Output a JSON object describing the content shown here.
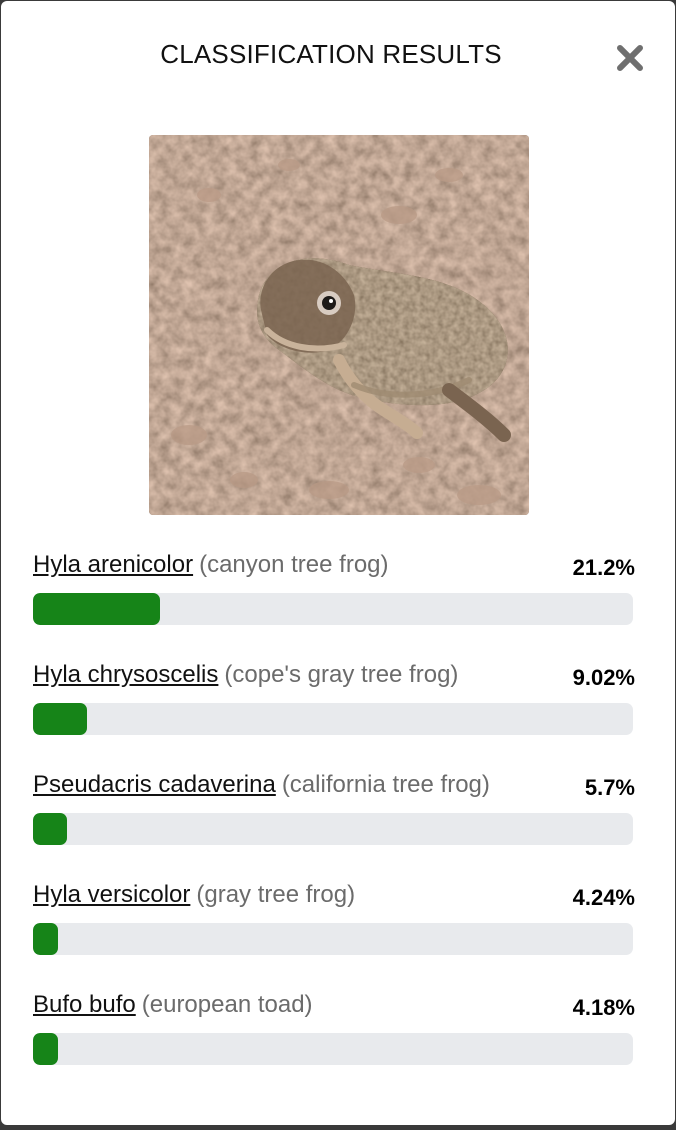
{
  "dialog": {
    "title": "CLASSIFICATION RESULTS",
    "close_icon": "close-icon"
  },
  "photo": {
    "icon": "frog-photo"
  },
  "results": [
    {
      "species": "Hyla arenicolor",
      "common": "(canyon tree frog)",
      "percent_label": "21.2%",
      "percent": 21.2
    },
    {
      "species": "Hyla chrysoscelis",
      "common": "(cope's gray tree frog)",
      "percent_label": "9.02%",
      "percent": 9.02
    },
    {
      "species": "Pseudacris cadaverina",
      "common": "(california tree frog)",
      "percent_label": "5.7%",
      "percent": 5.7
    },
    {
      "species": "Hyla versicolor",
      "common": "(gray tree frog)",
      "percent_label": "4.24%",
      "percent": 4.24
    },
    {
      "species": "Bufo bufo",
      "common": "(european toad)",
      "percent_label": "4.18%",
      "percent": 4.18
    }
  ],
  "colors": {
    "bar_fill": "#168418",
    "bar_track": "#e8eaed"
  }
}
